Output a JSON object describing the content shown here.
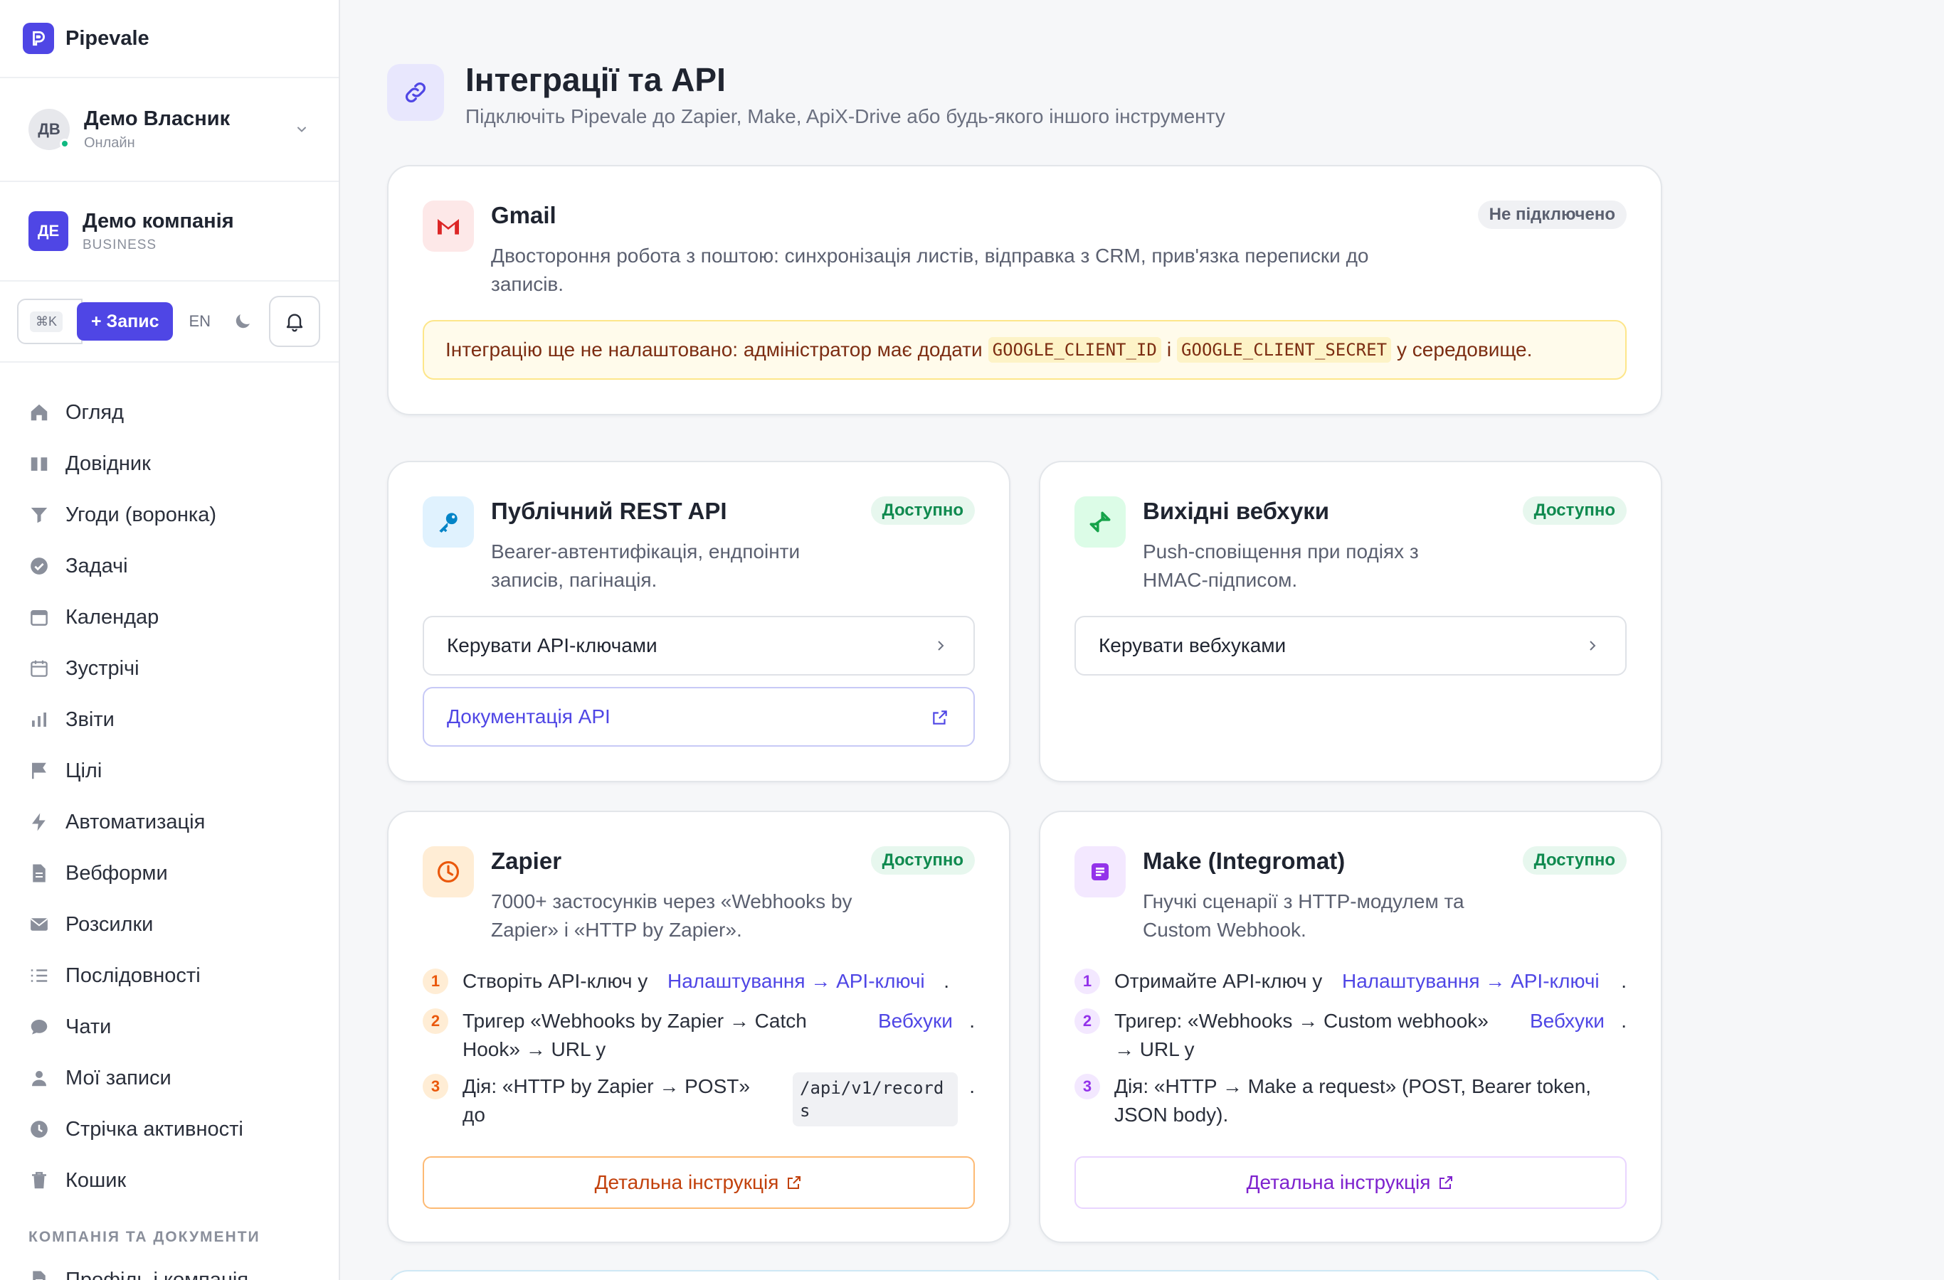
{
  "brand": {
    "name": "Pipevale"
  },
  "user": {
    "initials": "ДВ",
    "name": "Демо Власник",
    "status": "Онлайн"
  },
  "company": {
    "initials": "ДЕ",
    "name": "Демо компанія",
    "plan": "BUSINESS"
  },
  "toolbar": {
    "kbd_hint": "⌘K",
    "add_label": "+ Запис",
    "lang": "EN"
  },
  "nav": {
    "items": [
      {
        "label": "Огляд",
        "icon": "home-icon"
      },
      {
        "label": "Довідник",
        "icon": "book-icon"
      },
      {
        "label": "Угоди (воронка)",
        "icon": "funnel-icon"
      },
      {
        "label": "Задачі",
        "icon": "check-circle-icon"
      },
      {
        "label": "Календар",
        "icon": "calendar-icon"
      },
      {
        "label": "Зустрічі",
        "icon": "calendar-outline-icon"
      },
      {
        "label": "Звіти",
        "icon": "bar-chart-icon"
      },
      {
        "label": "Цілі",
        "icon": "flag-icon"
      },
      {
        "label": "Автоматизація",
        "icon": "bolt-icon"
      },
      {
        "label": "Вебформи",
        "icon": "document-icon"
      },
      {
        "label": "Розсилки",
        "icon": "envelope-icon"
      },
      {
        "label": "Послідовності",
        "icon": "list-numbered-icon"
      },
      {
        "label": "Чати",
        "icon": "chat-bubble-icon"
      },
      {
        "label": "Мої записи",
        "icon": "user-icon"
      },
      {
        "label": "Стрічка активності",
        "icon": "clock-icon"
      },
      {
        "label": "Кошик",
        "icon": "trash-icon"
      }
    ],
    "section_label": "КОМПАНІЯ ТА ДОКУМЕНТИ",
    "section_items": [
      {
        "label": "Профіль і компанія",
        "icon": "document-icon"
      }
    ]
  },
  "page": {
    "title": "Інтеграції та API",
    "subtitle": "Підключіть Pipevale до Zapier, Make, ApiX-Drive або будь-якого іншого інструменту"
  },
  "gmail": {
    "title": "Gmail",
    "badge": "Не підключено",
    "desc": "Двостороння робота з поштою: синхронізація листів, відправка з CRM, прив'язка переписки до записів.",
    "alert_pre": "Інтеграцію ще не налаштовано: адміністратор має додати",
    "alert_code1": "GOOGLE_CLIENT_ID",
    "alert_mid": "і",
    "alert_code2": "GOOGLE_CLIENT_SECRET",
    "alert_post": "у середовище."
  },
  "rest_api": {
    "title": "Публічний REST API",
    "badge": "Доступно",
    "desc": "Bearer-автентифікація, ендпоінти записів, пагінація.",
    "manage_label": "Керувати API-ключами",
    "docs_label": "Документація API"
  },
  "webhooks": {
    "title": "Вихідні вебхуки",
    "badge": "Доступно",
    "desc": "Push-сповіщення при подіях з HMAC-підписом.",
    "manage_label": "Керувати вебхуками"
  },
  "zapier": {
    "title": "Zapier",
    "badge": "Доступно",
    "desc": "7000+ застосунків через «Webhooks by Zapier» і «HTTP by Zapier».",
    "step1_text": "Створіть API-ключ у",
    "step1_link": "Налаштування → API-ключі",
    "step2_text": "Тригер «Webhooks by Zapier → Catch Hook» → URL у",
    "step2_link": "Вебхуки",
    "step3_text": "Дія: «HTTP by Zapier → POST» до",
    "step3_code": "/api/v1/records",
    "dot": ".",
    "detail_label": "Детальна інструкція"
  },
  "make": {
    "title": "Make (Integromat)",
    "badge": "Доступно",
    "desc": "Гнучкі сценарії з HTTP-модулем та Custom Webhook.",
    "step1_text": "Отримайте API-ключ у",
    "step1_link": "Налаштування → API-ключі",
    "step2_text": "Тригер: «Webhooks → Custom webhook» → URL у",
    "step2_link": "Вебхуки",
    "step3_text": "Дія: «HTTP → Make a request» (POST, Bearer token, JSON body).",
    "dot": ".",
    "detail_label": "Детальна інструкція"
  },
  "colors": {
    "accent": "#4f46e5",
    "success_bg": "#e7f7ee",
    "success_text": "#0f8a4f",
    "warning_bg": "#fffbeb",
    "zapier": "#ea580c",
    "make": "#9333ea"
  }
}
